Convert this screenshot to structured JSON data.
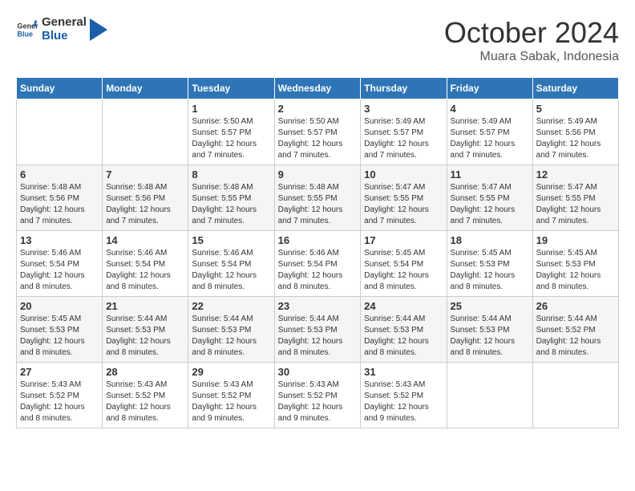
{
  "header": {
    "logo_line1": "General",
    "logo_line2": "Blue",
    "month": "October 2024",
    "location": "Muara Sabak, Indonesia"
  },
  "weekdays": [
    "Sunday",
    "Monday",
    "Tuesday",
    "Wednesday",
    "Thursday",
    "Friday",
    "Saturday"
  ],
  "weeks": [
    [
      {
        "day": "",
        "sunrise": "",
        "sunset": "",
        "daylight": ""
      },
      {
        "day": "",
        "sunrise": "",
        "sunset": "",
        "daylight": ""
      },
      {
        "day": "1",
        "sunrise": "Sunrise: 5:50 AM",
        "sunset": "Sunset: 5:57 PM",
        "daylight": "Daylight: 12 hours and 7 minutes."
      },
      {
        "day": "2",
        "sunrise": "Sunrise: 5:50 AM",
        "sunset": "Sunset: 5:57 PM",
        "daylight": "Daylight: 12 hours and 7 minutes."
      },
      {
        "day": "3",
        "sunrise": "Sunrise: 5:49 AM",
        "sunset": "Sunset: 5:57 PM",
        "daylight": "Daylight: 12 hours and 7 minutes."
      },
      {
        "day": "4",
        "sunrise": "Sunrise: 5:49 AM",
        "sunset": "Sunset: 5:57 PM",
        "daylight": "Daylight: 12 hours and 7 minutes."
      },
      {
        "day": "5",
        "sunrise": "Sunrise: 5:49 AM",
        "sunset": "Sunset: 5:56 PM",
        "daylight": "Daylight: 12 hours and 7 minutes."
      }
    ],
    [
      {
        "day": "6",
        "sunrise": "Sunrise: 5:48 AM",
        "sunset": "Sunset: 5:56 PM",
        "daylight": "Daylight: 12 hours and 7 minutes."
      },
      {
        "day": "7",
        "sunrise": "Sunrise: 5:48 AM",
        "sunset": "Sunset: 5:56 PM",
        "daylight": "Daylight: 12 hours and 7 minutes."
      },
      {
        "day": "8",
        "sunrise": "Sunrise: 5:48 AM",
        "sunset": "Sunset: 5:55 PM",
        "daylight": "Daylight: 12 hours and 7 minutes."
      },
      {
        "day": "9",
        "sunrise": "Sunrise: 5:48 AM",
        "sunset": "Sunset: 5:55 PM",
        "daylight": "Daylight: 12 hours and 7 minutes."
      },
      {
        "day": "10",
        "sunrise": "Sunrise: 5:47 AM",
        "sunset": "Sunset: 5:55 PM",
        "daylight": "Daylight: 12 hours and 7 minutes."
      },
      {
        "day": "11",
        "sunrise": "Sunrise: 5:47 AM",
        "sunset": "Sunset: 5:55 PM",
        "daylight": "Daylight: 12 hours and 7 minutes."
      },
      {
        "day": "12",
        "sunrise": "Sunrise: 5:47 AM",
        "sunset": "Sunset: 5:55 PM",
        "daylight": "Daylight: 12 hours and 7 minutes."
      }
    ],
    [
      {
        "day": "13",
        "sunrise": "Sunrise: 5:46 AM",
        "sunset": "Sunset: 5:54 PM",
        "daylight": "Daylight: 12 hours and 8 minutes."
      },
      {
        "day": "14",
        "sunrise": "Sunrise: 5:46 AM",
        "sunset": "Sunset: 5:54 PM",
        "daylight": "Daylight: 12 hours and 8 minutes."
      },
      {
        "day": "15",
        "sunrise": "Sunrise: 5:46 AM",
        "sunset": "Sunset: 5:54 PM",
        "daylight": "Daylight: 12 hours and 8 minutes."
      },
      {
        "day": "16",
        "sunrise": "Sunrise: 5:46 AM",
        "sunset": "Sunset: 5:54 PM",
        "daylight": "Daylight: 12 hours and 8 minutes."
      },
      {
        "day": "17",
        "sunrise": "Sunrise: 5:45 AM",
        "sunset": "Sunset: 5:54 PM",
        "daylight": "Daylight: 12 hours and 8 minutes."
      },
      {
        "day": "18",
        "sunrise": "Sunrise: 5:45 AM",
        "sunset": "Sunset: 5:53 PM",
        "daylight": "Daylight: 12 hours and 8 minutes."
      },
      {
        "day": "19",
        "sunrise": "Sunrise: 5:45 AM",
        "sunset": "Sunset: 5:53 PM",
        "daylight": "Daylight: 12 hours and 8 minutes."
      }
    ],
    [
      {
        "day": "20",
        "sunrise": "Sunrise: 5:45 AM",
        "sunset": "Sunset: 5:53 PM",
        "daylight": "Daylight: 12 hours and 8 minutes."
      },
      {
        "day": "21",
        "sunrise": "Sunrise: 5:44 AM",
        "sunset": "Sunset: 5:53 PM",
        "daylight": "Daylight: 12 hours and 8 minutes."
      },
      {
        "day": "22",
        "sunrise": "Sunrise: 5:44 AM",
        "sunset": "Sunset: 5:53 PM",
        "daylight": "Daylight: 12 hours and 8 minutes."
      },
      {
        "day": "23",
        "sunrise": "Sunrise: 5:44 AM",
        "sunset": "Sunset: 5:53 PM",
        "daylight": "Daylight: 12 hours and 8 minutes."
      },
      {
        "day": "24",
        "sunrise": "Sunrise: 5:44 AM",
        "sunset": "Sunset: 5:53 PM",
        "daylight": "Daylight: 12 hours and 8 minutes."
      },
      {
        "day": "25",
        "sunrise": "Sunrise: 5:44 AM",
        "sunset": "Sunset: 5:53 PM",
        "daylight": "Daylight: 12 hours and 8 minutes."
      },
      {
        "day": "26",
        "sunrise": "Sunrise: 5:44 AM",
        "sunset": "Sunset: 5:52 PM",
        "daylight": "Daylight: 12 hours and 8 minutes."
      }
    ],
    [
      {
        "day": "27",
        "sunrise": "Sunrise: 5:43 AM",
        "sunset": "Sunset: 5:52 PM",
        "daylight": "Daylight: 12 hours and 8 minutes."
      },
      {
        "day": "28",
        "sunrise": "Sunrise: 5:43 AM",
        "sunset": "Sunset: 5:52 PM",
        "daylight": "Daylight: 12 hours and 8 minutes."
      },
      {
        "day": "29",
        "sunrise": "Sunrise: 5:43 AM",
        "sunset": "Sunset: 5:52 PM",
        "daylight": "Daylight: 12 hours and 9 minutes."
      },
      {
        "day": "30",
        "sunrise": "Sunrise: 5:43 AM",
        "sunset": "Sunset: 5:52 PM",
        "daylight": "Daylight: 12 hours and 9 minutes."
      },
      {
        "day": "31",
        "sunrise": "Sunrise: 5:43 AM",
        "sunset": "Sunset: 5:52 PM",
        "daylight": "Daylight: 12 hours and 9 minutes."
      },
      {
        "day": "",
        "sunrise": "",
        "sunset": "",
        "daylight": ""
      },
      {
        "day": "",
        "sunrise": "",
        "sunset": "",
        "daylight": ""
      }
    ]
  ]
}
